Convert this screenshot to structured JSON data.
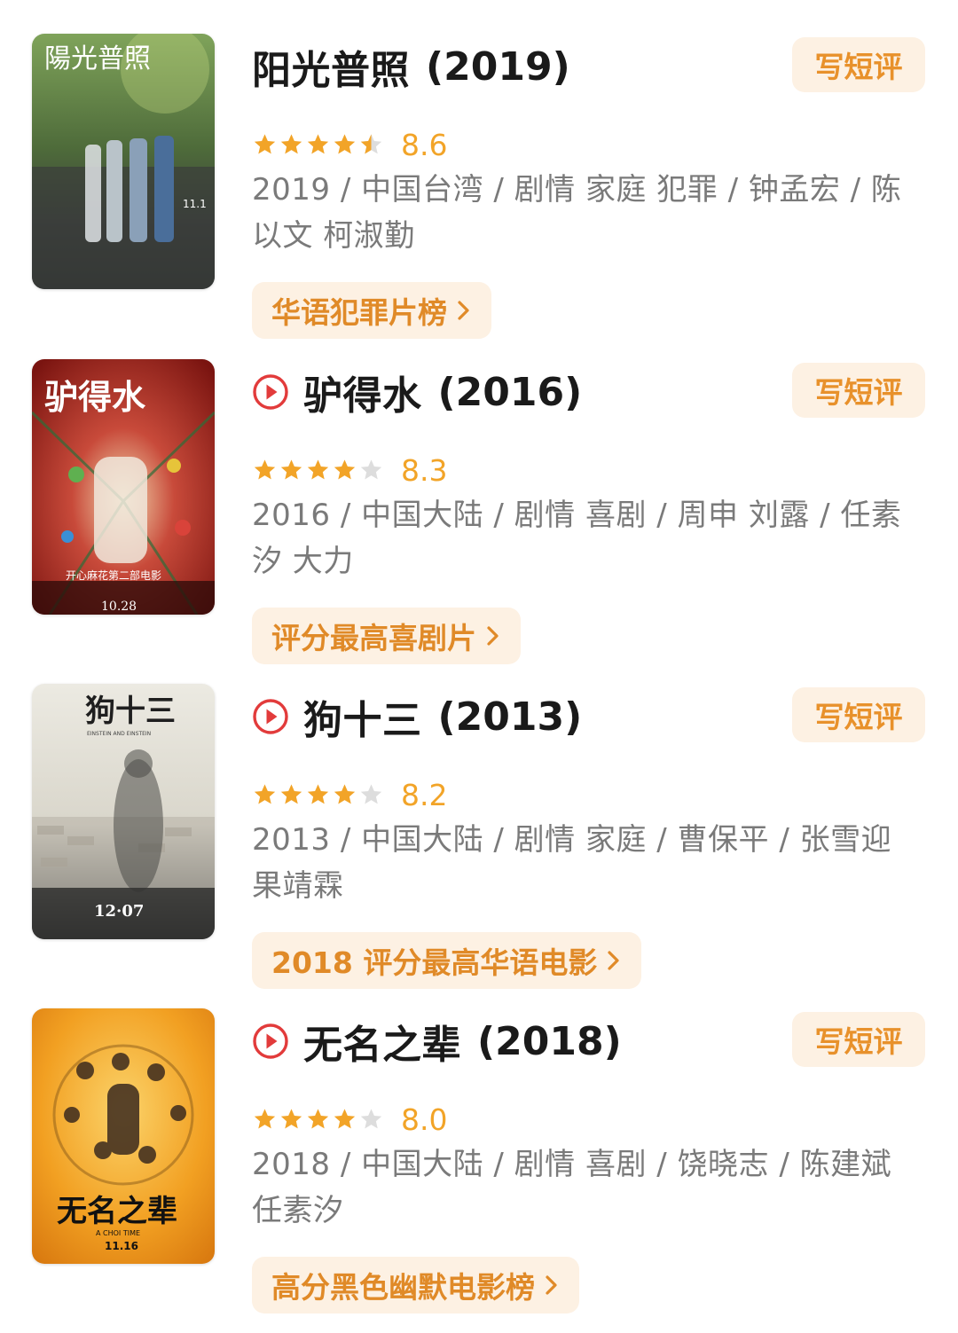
{
  "colors": {
    "accent": "#e8912b",
    "star": "#f2a428",
    "star_empty": "#dddddd",
    "play_icon": "#e23b3b",
    "tag_bg": "#fdf1e3",
    "meta_text": "#7a7a7a"
  },
  "movies": [
    {
      "title": "阳光普照",
      "year": "(2019)",
      "has_play_icon": false,
      "rating": 4.5,
      "score": "8.6",
      "meta": "2019 / 中国台湾 / 剧情 家庭 犯罪 / 钟孟宏 / 陈以文 柯淑勤",
      "tag": "华语犯罪片榜",
      "review_label": "写短评",
      "poster_text": "陽光普照",
      "poster_date": "11.1",
      "poster_theme": "green"
    },
    {
      "title": "驴得水",
      "year": "(2016)",
      "has_play_icon": true,
      "rating": 4,
      "score": "8.3",
      "meta": "2016 / 中国大陆 / 剧情 喜剧 / 周申 刘露 / 任素汐 大力",
      "tag": "评分最高喜剧片",
      "review_label": "写短评",
      "poster_text": "驴得水",
      "poster_subtext": "开心麻花第二部电影",
      "poster_date": "10.28",
      "poster_theme": "red"
    },
    {
      "title": "狗十三",
      "year": "(2013)",
      "has_play_icon": true,
      "rating": 4,
      "score": "8.2",
      "meta": "2013 / 中国大陆 / 剧情 家庭 / 曹保平 / 张雪迎 果靖霖",
      "tag": "2018 评分最高华语电影",
      "review_label": "写短评",
      "poster_text": "狗十三",
      "poster_subtext": "EINSTEIN AND EINSTEIN",
      "poster_date": "12·07",
      "poster_theme": "gray"
    },
    {
      "title": "无名之辈",
      "year": "(2018)",
      "has_play_icon": true,
      "rating": 4,
      "score": "8.0",
      "meta": "2018 / 中国大陆 / 剧情 喜剧 / 饶晓志 / 陈建斌 任素汐",
      "tag": "高分黑色幽默电影榜",
      "review_label": "写短评",
      "poster_text": "无名之辈",
      "poster_subtext": "A CHOI TIME",
      "poster_date": "11.16",
      "poster_theme": "orange"
    }
  ]
}
